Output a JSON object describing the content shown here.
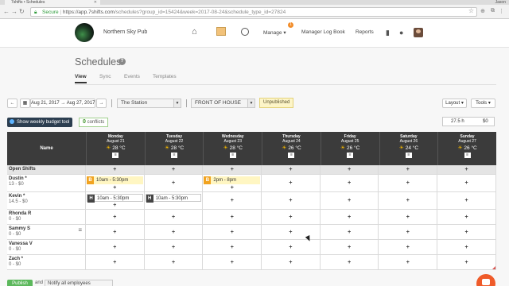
{
  "browser": {
    "tab_title": "7shifts • Schedules",
    "user_label": "Jason",
    "secure_label": "Secure",
    "url_host": "https://app.7shifts.com",
    "url_path": "/schedules?group_id=15424&week=2017-08-24&schedule_type_id=27824"
  },
  "header": {
    "business_name": "Northern Sky Pub",
    "manage_label": "Manage",
    "manage_badge": "1",
    "manager_log_label": "Manager Log Book",
    "reports_label": "Reports"
  },
  "page": {
    "title": "Schedules",
    "help": "?",
    "tabs": [
      {
        "label": "View",
        "active": true
      },
      {
        "label": "Sync",
        "active": false
      },
      {
        "label": "Events",
        "active": false
      },
      {
        "label": "Templates",
        "active": false
      }
    ]
  },
  "toolbar": {
    "week_range": "Aug 21, 2017 → Aug 27, 2017",
    "location": "The Station",
    "department": "FRONT OF HOUSE",
    "status": "Unpublished",
    "layout_label": "Layout",
    "tools_label": "Tools",
    "budget_button": "Show weekly budget tool",
    "conflicts_count": "0",
    "conflicts_label": "conflicts",
    "total_hours": "27.5 h",
    "total_cost": "$0"
  },
  "grid": {
    "name_header": "Name",
    "days": [
      {
        "name": "Monday",
        "date": "August 21",
        "temp": "28 °C",
        "weather": "sun"
      },
      {
        "name": "Tuesday",
        "date": "August 22",
        "temp": "28 °C",
        "weather": "sun"
      },
      {
        "name": "Wednesday",
        "date": "August 23",
        "temp": "28 °C",
        "weather": "sun"
      },
      {
        "name": "Thursday",
        "date": "August 24",
        "temp": "26 °C",
        "weather": "sun"
      },
      {
        "name": "Friday",
        "date": "August 25",
        "temp": "26 °C",
        "weather": "sun"
      },
      {
        "name": "Saturday",
        "date": "August 26",
        "temp": "24 °C",
        "weather": "sun"
      },
      {
        "name": "Sunday",
        "date": "August 27",
        "temp": "26 °C",
        "weather": "sun"
      }
    ],
    "rows": [
      {
        "name": "Open Shifts",
        "hours": "",
        "open": true
      },
      {
        "name": "Dustin *",
        "hours": "13 - $0"
      },
      {
        "name": "Kevin *",
        "hours": "14.5 - $0"
      },
      {
        "name": "Rhonda R",
        "hours": "0 - $0"
      },
      {
        "name": "Sammy S",
        "hours": "0 - $0"
      },
      {
        "name": "Vanessa V",
        "hours": "0 - $0"
      },
      {
        "name": "Zach *",
        "hours": "0 - $0"
      }
    ],
    "shifts": {
      "dustin_mon": {
        "tag": "B",
        "time": "10am - 5:30pm",
        "color": "#f1a320"
      },
      "dustin_wed": {
        "tag": "B",
        "time": "2pm - 8pm",
        "color": "#f1a320"
      },
      "kevin_mon": {
        "tag": "H",
        "time": "10am - 5:30pm",
        "color": "#444444"
      },
      "kevin_tue": {
        "tag": "H",
        "time": "10am - 5:30pm",
        "color": "#444444"
      }
    },
    "add_glyph": "+"
  },
  "footer": {
    "publish_label": "Publish",
    "and_label": "and",
    "notify_option": "Notify all employees"
  }
}
